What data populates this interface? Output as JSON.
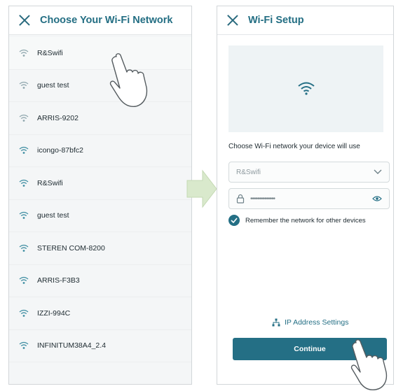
{
  "left_screen": {
    "title": "Choose Your Wi-Fi Network",
    "networks": [
      {
        "name": "R&Swifi"
      },
      {
        "name": "guest test"
      },
      {
        "name": "ARRIS-9202"
      },
      {
        "name": "icongo-87bfc2"
      },
      {
        "name": "R&Swifi"
      },
      {
        "name": "guest test"
      },
      {
        "name": "STEREN COM-8200"
      },
      {
        "name": "ARRIS-F3B3"
      },
      {
        "name": "IZZI-994C"
      },
      {
        "name": "INFINITUM38A4_2.4"
      }
    ]
  },
  "right_screen": {
    "title": "Wi-Fi Setup",
    "network_prompt": "Choose Wi-Fi network your device will use",
    "ssid_value": "R&Swifi",
    "password_value": "••••••••••••••",
    "remember_label": "Remember the network for other devices",
    "remember_checked": true,
    "ip_settings_label": "IP Address Settings",
    "continue_label": "Continue"
  },
  "colors": {
    "accent": "#246f85",
    "arrow": "#cfe3c0"
  },
  "icons": [
    "close-icon",
    "wifi-icon",
    "chevron-down-icon",
    "lock-icon",
    "eye-icon",
    "check-icon",
    "network-icon",
    "pointer-hand-icon",
    "arrow-right-icon"
  ]
}
